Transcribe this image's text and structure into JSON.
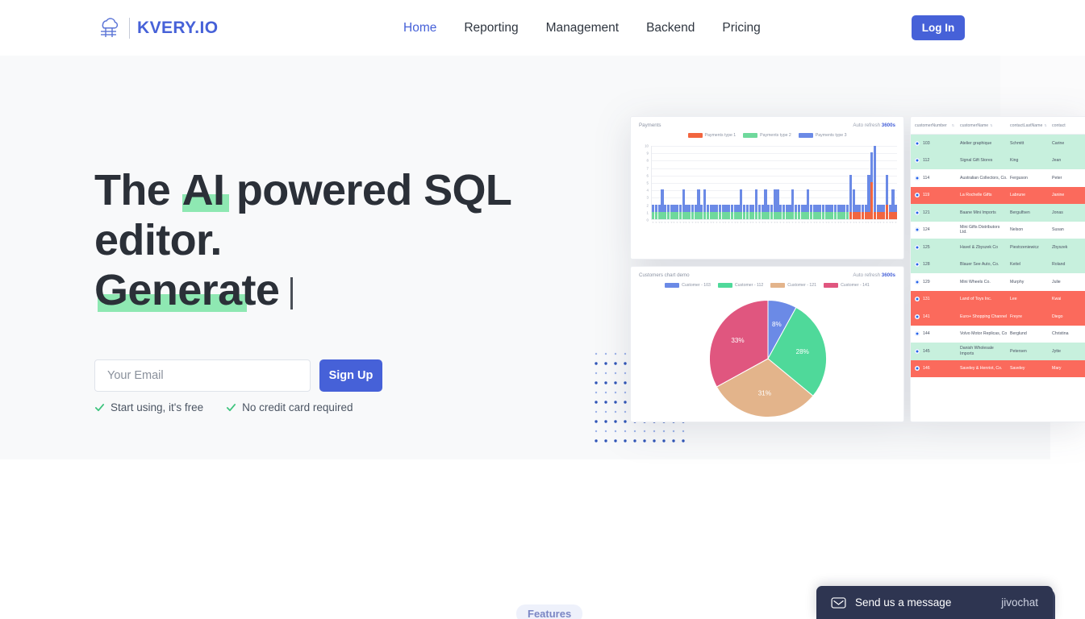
{
  "brand": {
    "name": "KVERY.IO",
    "logo_icon": "cloud-database-icon",
    "accent": "#4661d8"
  },
  "header": {
    "nav": [
      {
        "label": "Home",
        "active": true
      },
      {
        "label": "Reporting",
        "active": false
      },
      {
        "label": "Management",
        "active": false
      },
      {
        "label": "Backend",
        "active": false
      },
      {
        "label": "Pricing",
        "active": false
      }
    ],
    "login_label": "Log In"
  },
  "hero": {
    "headline_line1_a": "The ",
    "headline_line1_hl": "AI",
    "headline_line1_b": " powered SQL",
    "headline_line2": "editor.",
    "headline_line3_hl": "Generate",
    "email_placeholder": "Your Email",
    "email_value": "",
    "signup_label": "Sign Up",
    "perks": [
      {
        "icon": "check-icon",
        "label": "Start using, it's free"
      },
      {
        "icon": "check-icon",
        "label": "No credit card required"
      }
    ],
    "highlight_color": "#8ee8b2"
  },
  "dashboard": {
    "payments_card": {
      "title": "Payments",
      "refresh_label": "Auto refresh",
      "refresh_value": "3600s"
    },
    "customers_card": {
      "title": "Customers chart demo",
      "refresh_label": "Auto refresh",
      "refresh_value": "3600s"
    },
    "table": {
      "columns": [
        "customerNumber",
        "customerName",
        "contactLastName",
        "contact"
      ],
      "rows": [
        {
          "num": "103",
          "name": "Atelier graphique",
          "last": "Schmitt",
          "first": "Carine",
          "state": "green"
        },
        {
          "num": "112",
          "name": "Signal Gift Stores",
          "last": "King",
          "first": "Jean",
          "state": "green"
        },
        {
          "num": "114",
          "name": "Australian Collectors, Co.",
          "last": "Ferguson",
          "first": "Peter",
          "state": "white"
        },
        {
          "num": "119",
          "name": "La Rochelle Gifts",
          "last": "Labrune",
          "first": "Janine",
          "state": "red"
        },
        {
          "num": "121",
          "name": "Baane Mini Imports",
          "last": "Bergulfsen",
          "first": "Jonas",
          "state": "green"
        },
        {
          "num": "124",
          "name": "Mini Gifts Distributors Ltd.",
          "last": "Nelson",
          "first": "Susan",
          "state": "white"
        },
        {
          "num": "125",
          "name": "Havel & Zbyszek Co",
          "last": "Piestrzeniewicz",
          "first": "Zbyszek",
          "state": "green"
        },
        {
          "num": "128",
          "name": "Blauer See Auto, Co.",
          "last": "Keitel",
          "first": "Roland",
          "state": "green"
        },
        {
          "num": "129",
          "name": "Mini Wheels Co.",
          "last": "Murphy",
          "first": "Julie",
          "state": "white"
        },
        {
          "num": "131",
          "name": "Land of Toys Inc.",
          "last": "Lee",
          "first": "Kwai",
          "state": "red"
        },
        {
          "num": "141",
          "name": "Euro+ Shopping Channel",
          "last": "Freyre",
          "first": "Diego",
          "state": "red"
        },
        {
          "num": "144",
          "name": "Volvo Motor Replicas, Co",
          "last": "Berglund",
          "first": "Christina",
          "state": "white"
        },
        {
          "num": "145",
          "name": "Danish Wholesale Imports",
          "last": "Petersen",
          "first": "Jytte",
          "state": "green"
        },
        {
          "num": "146",
          "name": "Saveley & Henriot, Co.",
          "last": "Saveley",
          "first": "Mary",
          "state": "red"
        }
      ]
    }
  },
  "features_badge": "Features",
  "chat": {
    "icon": "envelope-icon",
    "label": "Send us a message",
    "brand": "jivochat"
  },
  "chart_data": [
    {
      "type": "bar",
      "title": "Payments",
      "stacked": true,
      "xlabel": "",
      "ylabel": "",
      "ylim": [
        0,
        10
      ],
      "yticks": [
        0,
        1,
        2,
        3,
        4,
        5,
        6,
        7,
        8,
        9,
        10
      ],
      "grid": true,
      "legend_position": "top",
      "colors": [
        "#f2653f",
        "#6fd99c",
        "#6b8ae6"
      ],
      "categories": [
        "2003-01-16",
        "2003-01-28",
        "2003-02-20",
        "2003-02-25",
        "2003-03-10",
        "2003-03-18",
        "2003-03-27",
        "2003-04-09",
        "2003-04-23",
        "2003-05-20",
        "2003-05-31",
        "2003-06-03",
        "2003-06-18",
        "2003-06-25",
        "2003-07-02",
        "2003-07-16",
        "2003-07-28",
        "2003-08-02",
        "2003-08-15",
        "2003-08-20",
        "2003-09-06",
        "2003-09-18",
        "2003-09-22",
        "2003-10-04",
        "2003-10-17",
        "2003-10-28",
        "2003-11-03",
        "2003-11-12",
        "2003-11-18",
        "2003-11-24",
        "2003-12-05",
        "2003-12-12",
        "2003-12-17",
        "2003-12-26",
        "2004-01-07",
        "2004-01-19",
        "2004-01-30",
        "2004-02-10",
        "2004-02-22",
        "2004-03-05",
        "2004-03-16",
        "2004-03-28",
        "2004-04-08",
        "2004-04-20",
        "2004-05-01",
        "2004-05-14",
        "2004-05-26",
        "2004-06-06",
        "2004-06-17",
        "2004-06-29",
        "2004-07-10",
        "2004-07-22",
        "2004-08-02",
        "2004-08-14",
        "2004-08-25",
        "2004-09-05",
        "2004-09-16",
        "2004-09-28",
        "2004-10-09",
        "2004-10-21",
        "2004-11-01",
        "2004-11-13",
        "2004-11-24",
        "2004-12-06",
        "2004-12-17",
        "2004-12-29",
        "2005-01-10",
        "2005-01-21",
        "2005-02-02",
        "2005-02-14",
        "2005-02-25",
        "2005-03-09",
        "2005-03-20",
        "2005-04-01",
        "2005-04-12",
        "2005-04-24",
        "2005-05-05",
        "2005-05-17",
        "2005-05-28",
        "2005-06-08",
        "2005-06-20"
      ],
      "series": [
        {
          "name": "Payments type 1",
          "color": "#f2653f",
          "values": [
            0,
            0,
            0,
            0,
            0,
            0,
            0,
            0,
            0,
            0,
            0,
            0,
            0,
            0,
            0,
            0,
            0,
            0,
            0,
            0,
            0,
            0,
            0,
            0,
            0,
            0,
            0,
            0,
            0,
            0,
            0,
            0,
            0,
            0,
            0,
            0,
            0,
            0,
            0,
            0,
            0,
            0,
            0,
            0,
            0,
            0,
            0,
            0,
            0,
            0,
            0,
            0,
            0,
            0,
            0,
            0,
            0,
            0,
            0,
            0,
            0,
            0,
            0,
            0,
            0,
            1,
            1,
            1,
            1,
            1,
            1,
            1,
            5,
            1,
            1,
            1,
            1,
            2,
            1,
            1,
            1
          ]
        },
        {
          "name": "Payments type 2",
          "color": "#6fd99c",
          "values": [
            1,
            1,
            1,
            1,
            1,
            1,
            1,
            1,
            1,
            1,
            1,
            1,
            1,
            1,
            1,
            1,
            1,
            1,
            1,
            1,
            1,
            1,
            1,
            1,
            1,
            1,
            1,
            1,
            1,
            1,
            1,
            1,
            1,
            1,
            1,
            1,
            1,
            1,
            1,
            1,
            1,
            1,
            1,
            1,
            1,
            1,
            1,
            1,
            1,
            1,
            1,
            1,
            1,
            1,
            1,
            1,
            1,
            1,
            1,
            1,
            1,
            1,
            1,
            1,
            1,
            0,
            0,
            0,
            0,
            0,
            0,
            0,
            0,
            0,
            0,
            0,
            0,
            0,
            0,
            0,
            0
          ]
        },
        {
          "name": "Payments type 3",
          "color": "#6b8ae6",
          "values": [
            1,
            1,
            1,
            3,
            1,
            1,
            1,
            1,
            1,
            1,
            3,
            1,
            1,
            1,
            1,
            3,
            1,
            3,
            1,
            1,
            1,
            1,
            1,
            1,
            1,
            1,
            1,
            1,
            1,
            3,
            1,
            1,
            1,
            1,
            3,
            1,
            1,
            3,
            1,
            1,
            3,
            3,
            1,
            1,
            1,
            1,
            3,
            1,
            1,
            1,
            1,
            3,
            1,
            1,
            1,
            1,
            1,
            1,
            1,
            1,
            1,
            1,
            1,
            1,
            1,
            5,
            3,
            1,
            1,
            1,
            1,
            5,
            4,
            9,
            1,
            1,
            1,
            4,
            1,
            3,
            1
          ]
        }
      ]
    },
    {
      "type": "pie",
      "title": "Customers chart demo",
      "legend_position": "top",
      "labels": [
        "Customer - 103",
        "Customer - 112",
        "Customer - 121",
        "Customer - 141"
      ],
      "values": [
        8,
        28,
        31,
        33
      ],
      "display_labels": [
        "8%",
        "28%",
        "31%",
        "33%"
      ],
      "colors": [
        "#6b8ae6",
        "#4fd99a",
        "#e3b48b",
        "#e0567f"
      ]
    }
  ]
}
